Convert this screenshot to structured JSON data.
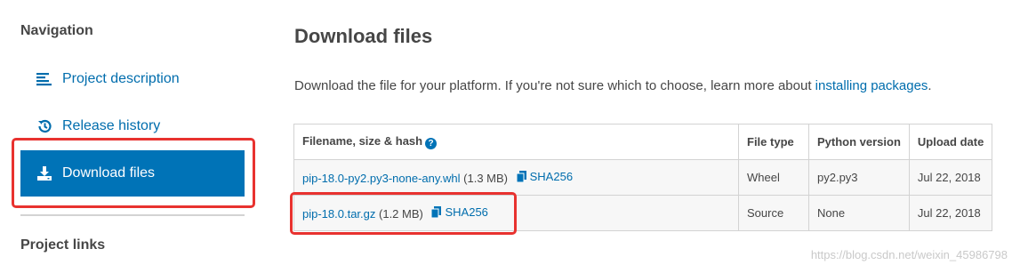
{
  "sidebar": {
    "heading": "Navigation",
    "items": [
      {
        "label": "Project description",
        "icon": "align-left-icon"
      },
      {
        "label": "Release history",
        "icon": "history-icon"
      },
      {
        "label": "Download files",
        "icon": "download-icon",
        "active": true
      }
    ],
    "links_heading": "Project links"
  },
  "main": {
    "title": "Download files",
    "intro_text": "Download the file for your platform. If you're not sure which to choose, learn more about",
    "intro_link": "installing packages",
    "intro_end": ".",
    "table": {
      "headers": [
        "Filename, size & hash",
        "File type",
        "Python version",
        "Upload date"
      ],
      "rows": [
        {
          "filename": "pip-18.0-py2.py3-none-any.whl",
          "size": "(1.3 MB)",
          "hash": "SHA256",
          "file_type": "Wheel",
          "python_version": "py2.py3",
          "upload_date": "Jul 22, 2018"
        },
        {
          "filename": "pip-18.0.tar.gz",
          "size": "(1.2 MB)",
          "hash": "SHA256",
          "file_type": "Source",
          "python_version": "None",
          "upload_date": "Jul 22, 2018"
        }
      ]
    }
  },
  "watermark": "https://blog.csdn.net/weixin_45986798",
  "colors": {
    "accent": "#0073b7",
    "link": "#006dad",
    "highlight": "#e8322f"
  }
}
